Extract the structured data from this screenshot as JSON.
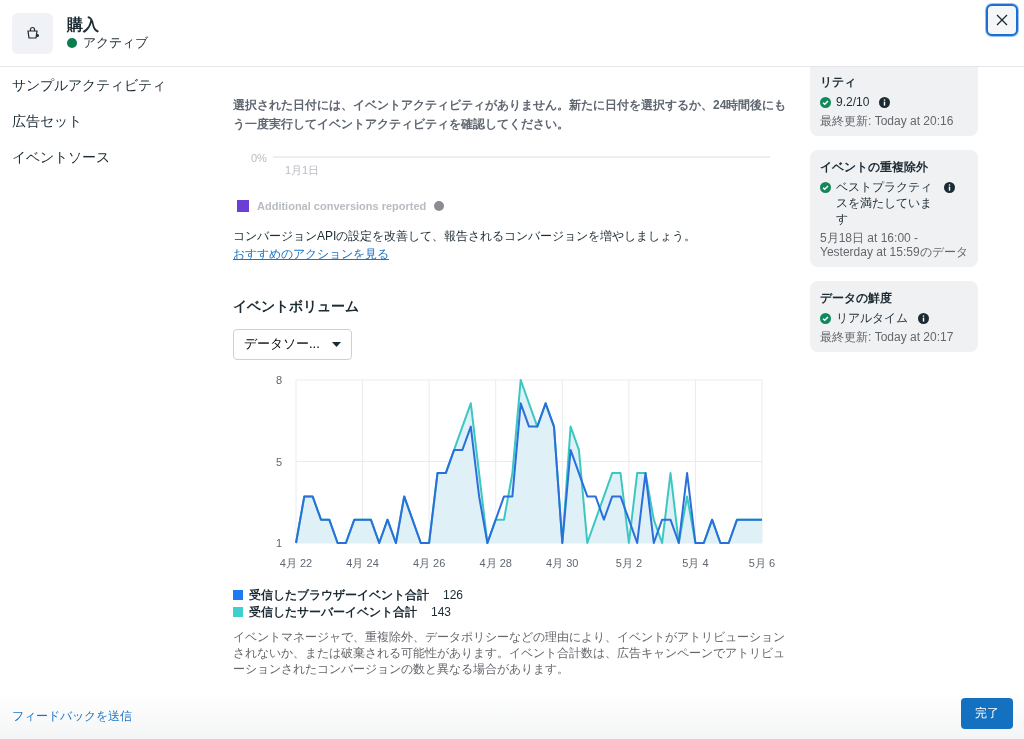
{
  "header": {
    "title": "購入",
    "status": {
      "label": "アクティブ",
      "active": true
    }
  },
  "sidebar": {
    "items": [
      {
        "label": "サンプルアクティビティ"
      },
      {
        "label": "広告セット"
      },
      {
        "label": "イベントソース"
      }
    ]
  },
  "main": {
    "notice": "選択された日付には、イベントアクティビティがありません。新たに日付を選択するか、24時間後にもう一度実行してイベントアクティビティを確認してください。",
    "empty_chart": {
      "y_label": "0%",
      "x_label": "1月1日"
    },
    "conversions_legend": {
      "label": "Additional conversions reported",
      "color": "#6a3fd6"
    },
    "tip": {
      "text": "コンバージョンAPIの設定を改善して、報告されるコンバージョンを増やしましょう。",
      "link": "おすすめのアクションを見る"
    },
    "volume": {
      "title": "イベントボリューム",
      "dropdown": {
        "value": "データソー..."
      },
      "chart_data": {
        "type": "line",
        "grid": true,
        "ylim": [
          1,
          8
        ],
        "yticks": [
          1,
          {
            "value": 4.5,
            "label": "5"
          },
          8
        ],
        "categories": [
          "4月 22",
          null,
          null,
          null,
          null,
          null,
          null,
          null,
          "4月 24",
          null,
          null,
          null,
          null,
          null,
          null,
          null,
          "4月 26",
          null,
          null,
          null,
          null,
          null,
          null,
          null,
          "4月 28",
          null,
          null,
          null,
          null,
          null,
          null,
          null,
          "4月 30",
          null,
          null,
          null,
          null,
          null,
          null,
          null,
          "5月 2",
          null,
          null,
          null,
          null,
          null,
          null,
          null,
          "5月 4",
          null,
          null,
          null,
          null,
          null,
          null,
          null,
          "5月 6"
        ],
        "series": [
          {
            "color": "#2a6fdb",
            "values": [
              1,
              3,
              3,
              2,
              2,
              1,
              1,
              2,
              2,
              2,
              1,
              2,
              1,
              3,
              2,
              1,
              1,
              4,
              4,
              5,
              5,
              6,
              3,
              1,
              2,
              3,
              3,
              7,
              6,
              6,
              7,
              6,
              1,
              5,
              4,
              3,
              3,
              2,
              3,
              3,
              2,
              1,
              4,
              1,
              2,
              2,
              1,
              4,
              1,
              1,
              2,
              1,
              1,
              2,
              2,
              2,
              2
            ]
          },
          {
            "color": "#3cc8c2",
            "values": [
              1,
              3,
              3,
              2,
              2,
              1,
              1,
              2,
              2,
              2,
              1,
              2,
              1,
              3,
              2,
              1,
              1,
              4,
              4,
              5,
              6,
              7,
              4,
              1,
              2,
              2,
              4,
              8,
              7,
              6,
              7,
              6,
              1,
              6,
              5,
              1,
              2,
              3,
              4,
              4,
              1,
              4,
              4,
              2,
              1,
              4,
              1,
              3,
              1,
              1,
              2,
              1,
              1,
              2,
              2,
              2,
              2
            ]
          }
        ]
      },
      "legend": [
        {
          "label": "受信したブラウザーイベント合計",
          "total": "126",
          "color": "#1a7cf0"
        },
        {
          "label": "受信したサーバーイベント合計",
          "total": "143",
          "color": "#3fcfcd"
        }
      ],
      "disclaimer": "イベントマネージャで、重複除外、データポリシーなどの理由により、イベントがアトリビューションされないか、または破棄される可能性があります。イベント合計数は、広告キャンペーンでアトリビューションされたコンバージョンの数と異なる場合があります。"
    }
  },
  "cards": [
    {
      "title": "リティ",
      "value": "9.2/10",
      "ok": true,
      "info": true,
      "note": "最終更新: Today at 20:16"
    },
    {
      "title": "イベントの重複除外",
      "value": "ベストプラクティスを満たしています",
      "ok": true,
      "info": true,
      "note": "5月18日 at 16:00 - Yesterday at 15:59のデータ"
    },
    {
      "title": "データの鮮度",
      "value": "リアルタイム",
      "ok": true,
      "info": true,
      "note": "最終更新: Today at 20:17"
    }
  ],
  "footer": {
    "feedback": "フィードバックを送信",
    "done": "完了"
  }
}
